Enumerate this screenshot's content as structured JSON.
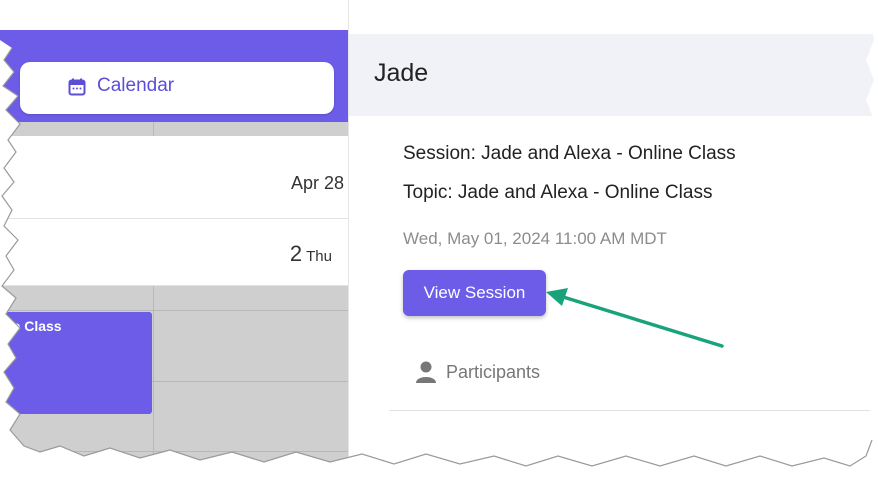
{
  "sidebar": {
    "calendar_tab_label": "Calendar"
  },
  "calendar": {
    "week_label": "Apr 28",
    "day_number": "2",
    "day_name": "Thu",
    "event_label": "ne Class"
  },
  "session_panel": {
    "name": "Jade",
    "session_line": "Session: Jade and Alexa - Online Class",
    "topic_line": "Topic: Jade and Alexa - Online Class",
    "date_line": "Wed, May 01, 2024 11:00 AM MDT",
    "view_button_label": "View Session",
    "participants_label": "Participants"
  },
  "colors": {
    "accent": "#6c5ce7",
    "annotation_arrow": "#1aa37a"
  },
  "icons": [
    "calendar-icon",
    "person-icon"
  ]
}
